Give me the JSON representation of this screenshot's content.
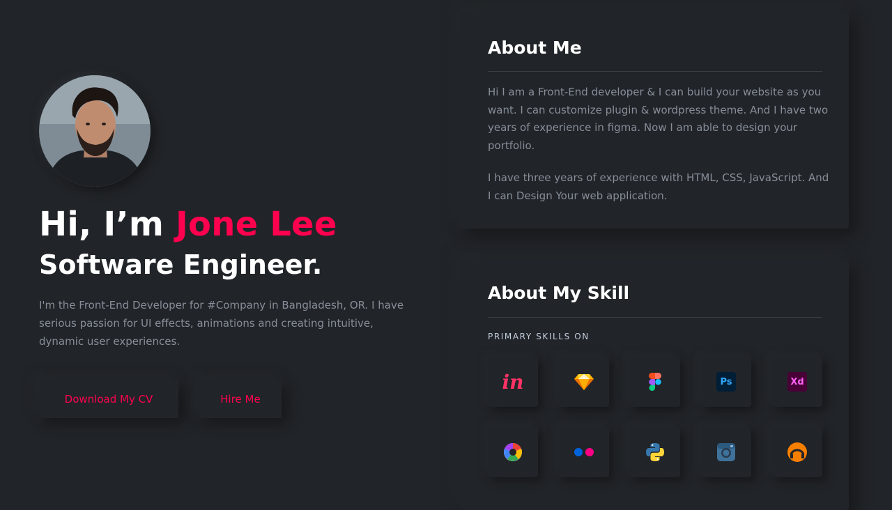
{
  "hero": {
    "greeting": "Hi, I’m ",
    "name": "Jone Lee",
    "title": "Software Engineer.",
    "intro": "I'm the Front-End Developer for #Company in Bangladesh, OR. I have serious passion for UI effects, animations and creating intuitive, dynamic user experiences.",
    "buttons": {
      "cv": "Download My CV",
      "hire": "Hire Me"
    }
  },
  "about": {
    "heading": "About Me",
    "paragraphs": [
      "Hi I am a Front-End developer & I can build your website as you want. I can customize plugin & wordpress theme. And I have two years of experience in figma. Now I am able to design your portfolio.",
      "I have three years of experience with HTML, CSS, JavaScript. And I can Design Your web application."
    ]
  },
  "skills": {
    "heading": "About My Skill",
    "label": "PRIMARY SKILLS ON",
    "icons": [
      "invision-icon",
      "sketch-icon",
      "figma-icon",
      "photoshop-icon",
      "adobe-xd-icon",
      "picasa-icon",
      "flickr-icon",
      "python-icon",
      "instagram-icon",
      "grooveshark-icon"
    ],
    "icon_text": {
      "invision": "in",
      "photoshop": "Ps",
      "xd": "Xd"
    }
  },
  "colors": {
    "background": "#212428",
    "accent": "#ff014f",
    "heading": "#ffffff",
    "body_text": "#878e99"
  }
}
